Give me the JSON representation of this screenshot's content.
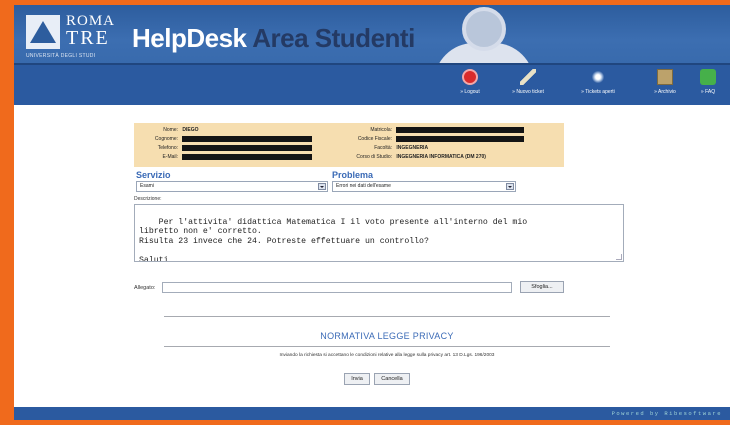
{
  "header": {
    "logo_roma": "ROMA",
    "logo_tre": "TRE",
    "logo_sub": "UNIVERSITÀ DEGLI STUDI",
    "title_part1": "HelpDesk",
    "title_part2": "Area Studenti"
  },
  "nav": [
    {
      "label": "» Logout",
      "icon": "power-icon"
    },
    {
      "label": "» Nuovo ticket",
      "icon": "broom-icon"
    },
    {
      "label": "» Tickets aperti",
      "icon": "sparkle-icon"
    },
    {
      "label": "» Archivio",
      "icon": "archive-icon"
    },
    {
      "label": "» FAQ",
      "icon": "faq-icon"
    }
  ],
  "info": {
    "nome_label": "Nome:",
    "nome_value": "DIEGO",
    "cognome_label": "Cognome:",
    "telefono_label": "Telefono:",
    "email_label": "E-Mail:",
    "matricola_label": "Matricola:",
    "codice_fiscale_label": "Codice Fiscale:",
    "facolta_label": "Facoltà:",
    "facolta_value": "INGEGNERIA",
    "corso_label": "Corso di Studio:",
    "corso_value": "INGEGNERIA INFORMATICA (DM 270)"
  },
  "form": {
    "servizio_label": "Servizio",
    "servizio_value": "Esami",
    "problema_label": "Problema",
    "problema_value": "Errori nei dati dell'esame",
    "descrizione_label": "Descrizione:",
    "descrizione_text": "Per l'attivita' didattica Matematica I il voto presente all'interno del mio\nlibretto non e' corretto.\nRisulta 23 invece che 24. Potreste effettuare un controllo?\n\nSaluti",
    "allegato_label": "Allegato:",
    "sfoglia_label": "Sfoglia..."
  },
  "privacy": {
    "title": "NORMATIVA LEGGE PRIVACY",
    "text": "Inviando la richiesta si accettano le condizioni relative alla legge sulla privacy art. 13 D.Lgs. 196/2003"
  },
  "actions": {
    "invia_label": "Invia",
    "cancella_label": "Cancella"
  },
  "footer": {
    "powered": "Powered by Ribesoftware"
  }
}
